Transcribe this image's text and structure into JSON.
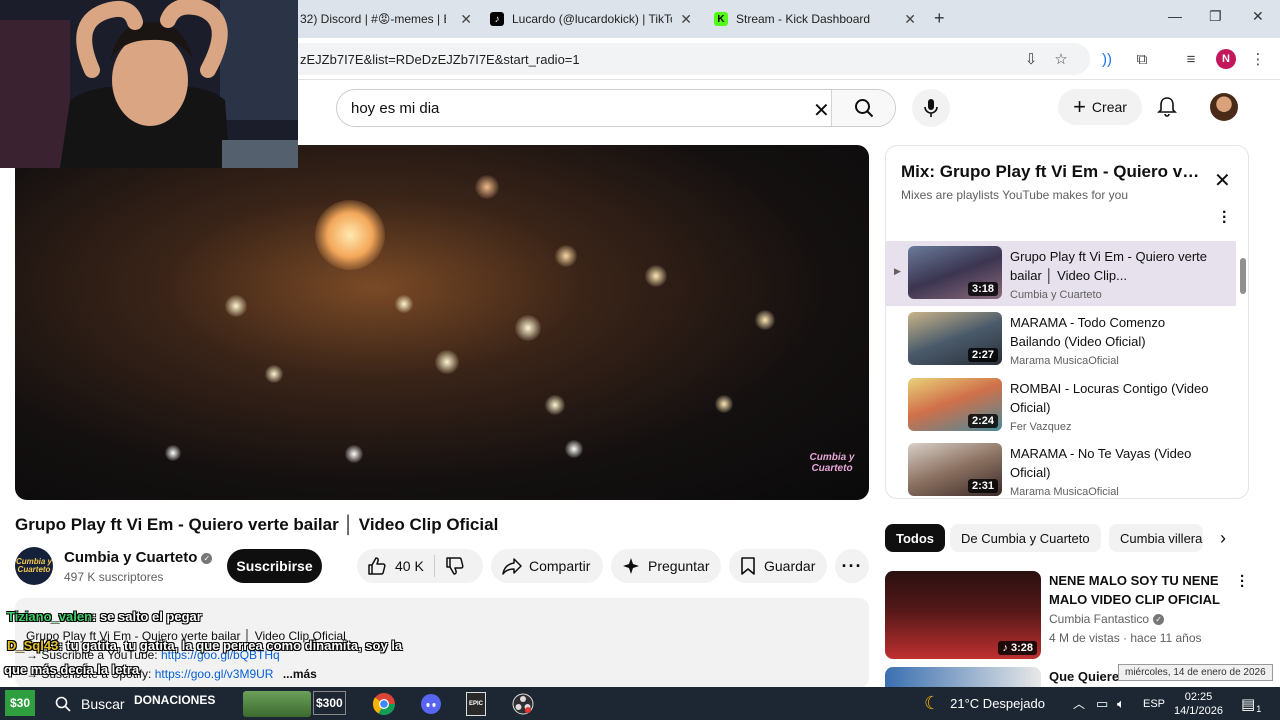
{
  "browser": {
    "tabs": [
      {
        "title": "32) Discord | #😡-memes | E",
        "favicon": "discord",
        "color": "#5865f2"
      },
      {
        "title": "Lucardo (@lucardokick) | TikTok",
        "favicon": "tiktok",
        "color": "#000000"
      },
      {
        "title": "Stream - Kick Dashboard",
        "favicon": "kick",
        "color": "#53fc18"
      }
    ],
    "new_tab": "+",
    "url": "zEJZb7I7E&list=RDeDzEJZb7I7E&start_radio=1",
    "profile_initial": "N"
  },
  "youtube": {
    "search_value": "hoy es mi dia",
    "create_label": "Crear"
  },
  "video": {
    "title": "Grupo Play ft Vi Em - Quiero verte bailar │ Video Clip Oficial",
    "watermark": "Cumbia y Cuarteto",
    "channel_logo_text": "Cumbia y Cuarteto",
    "channel": "Cumbia y Cuarteto",
    "subscribers": "497 K suscriptores",
    "subscribe_label": "Suscribirse",
    "likes": "40 K",
    "share_label": "Compartir",
    "ask_label": "Preguntar",
    "save_label": "Guardar",
    "description": {
      "line1": "Grupo Play ft Vi Em - Quiero verte bailar │ Video Clip Oficial",
      "line2_prefix": "→ Suscribite a YouTube:",
      "line2_link": "https://goo.gl/bQBTHq",
      "line3_prefix": "→ Suscribete a Spotify:",
      "line3_link": "https://goo.gl/v3M9UR",
      "more": "...más"
    }
  },
  "chat": [
    {
      "user": "Tiziano_valen",
      "user_color": "#41d06a",
      "message": ": se salto el pegar"
    },
    {
      "user": "D_Sql43",
      "user_color": "#e6c229",
      "message": ": tu gatita, tu gatita, la que perrea como dinamita, soy la"
    },
    {
      "user": "",
      "user_color": "#ffffff",
      "message": "que más decía la letra"
    }
  ],
  "mix": {
    "title": "Mix: Grupo Play ft Vi Em - Quiero verte bailar │ Video Clip Oficial",
    "subtitle": "Mixes are playlists YouTube makes for you",
    "items": [
      {
        "title": "Grupo Play ft Vi Em - Quiero verte bailar │ Video Clip...",
        "channel": "Cumbia y Cuarteto",
        "duration": "3:18",
        "active": true
      },
      {
        "title": "MARAMA - Todo Comenzo Bailando (Video Oficial)",
        "channel": "Marama MusicaOficial",
        "duration": "2:27",
        "active": false
      },
      {
        "title": "ROMBAI - Locuras Contigo (Video Oficial)",
        "channel": "Fer Vazquez",
        "duration": "2:24",
        "active": false
      },
      {
        "title": "MARAMA - No Te Vayas (Video Oficial)",
        "channel": "Marama MusicaOficial",
        "duration": "2:31",
        "active": false
      }
    ]
  },
  "chips": [
    "Todos",
    "De Cumbia y Cuarteto",
    "Cumbia villera"
  ],
  "recommendation": {
    "title": "NENE MALO  SOY TU NENE MALO  VIDEO CLIP OFICIAL",
    "channel": "Cumbia Fantastico",
    "meta": "4 M de vistas · hace 11 años",
    "duration": "3:28"
  },
  "recommendation2": {
    "title": "Que Quiere"
  },
  "tooltip": "miércoles, 14 de enero de 2026",
  "taskbar": {
    "overlay_price": "$30",
    "search": "Buscar",
    "donaciones": "DONACIONES",
    "overlay_price2": "$300",
    "weather": "21°C  Despejado",
    "language": "ESP",
    "time": "02:25",
    "date": "14/1/2026",
    "notifications": "1"
  }
}
